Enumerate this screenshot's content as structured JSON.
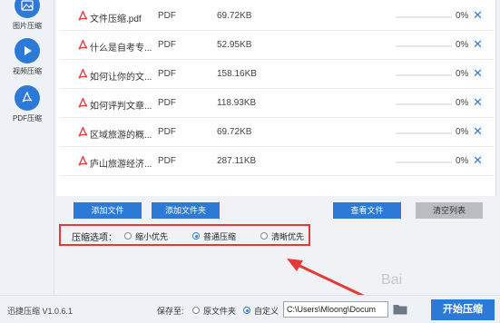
{
  "sidebar": {
    "items": [
      {
        "label": "图片压缩",
        "icon": "image-icon"
      },
      {
        "label": "视频压缩",
        "icon": "play-icon"
      },
      {
        "label": "PDF压缩",
        "icon": "pdf-icon"
      }
    ]
  },
  "files": [
    {
      "name": "文件压缩.pdf",
      "type": "PDF",
      "size": "69.72KB",
      "progress": "0%"
    },
    {
      "name": "什么是自考专...",
      "type": "PDF",
      "size": "52.95KB",
      "progress": "0%"
    },
    {
      "name": "如何让你的文...",
      "type": "PDF",
      "size": "158.16KB",
      "progress": "0%"
    },
    {
      "name": "如何评判文章...",
      "type": "PDF",
      "size": "118.93KB",
      "progress": "0%"
    },
    {
      "name": "区域旅游的概...",
      "type": "PDF",
      "size": "69.72KB",
      "progress": "0%"
    },
    {
      "name": "庐山旅游经济...",
      "type": "PDF",
      "size": "287.11KB",
      "progress": "0%"
    }
  ],
  "remove_glyph": "✕",
  "buttons": {
    "add_file": "添加文件",
    "add_folder": "添加文件夹",
    "view_file": "查看文件",
    "clear_list": "清空列表"
  },
  "compress_options": {
    "label": "压缩选项：",
    "options": [
      "缩小优先",
      "普通压缩",
      "清晰优先"
    ],
    "selected": "普通压缩"
  },
  "footer": {
    "version": "迅捷压缩 V1.0.6.1",
    "save_to_label": "保存至:",
    "save_options": [
      "原文件夹",
      "自定义"
    ],
    "save_selected": "自定义",
    "path_value": "C:\\Users\\Mloong\\Docum",
    "start_button": "开始压缩"
  },
  "watermark": "Bai",
  "colors": {
    "accent": "#2d79d6",
    "highlight": "#e53935",
    "pdf": "#e53935"
  }
}
